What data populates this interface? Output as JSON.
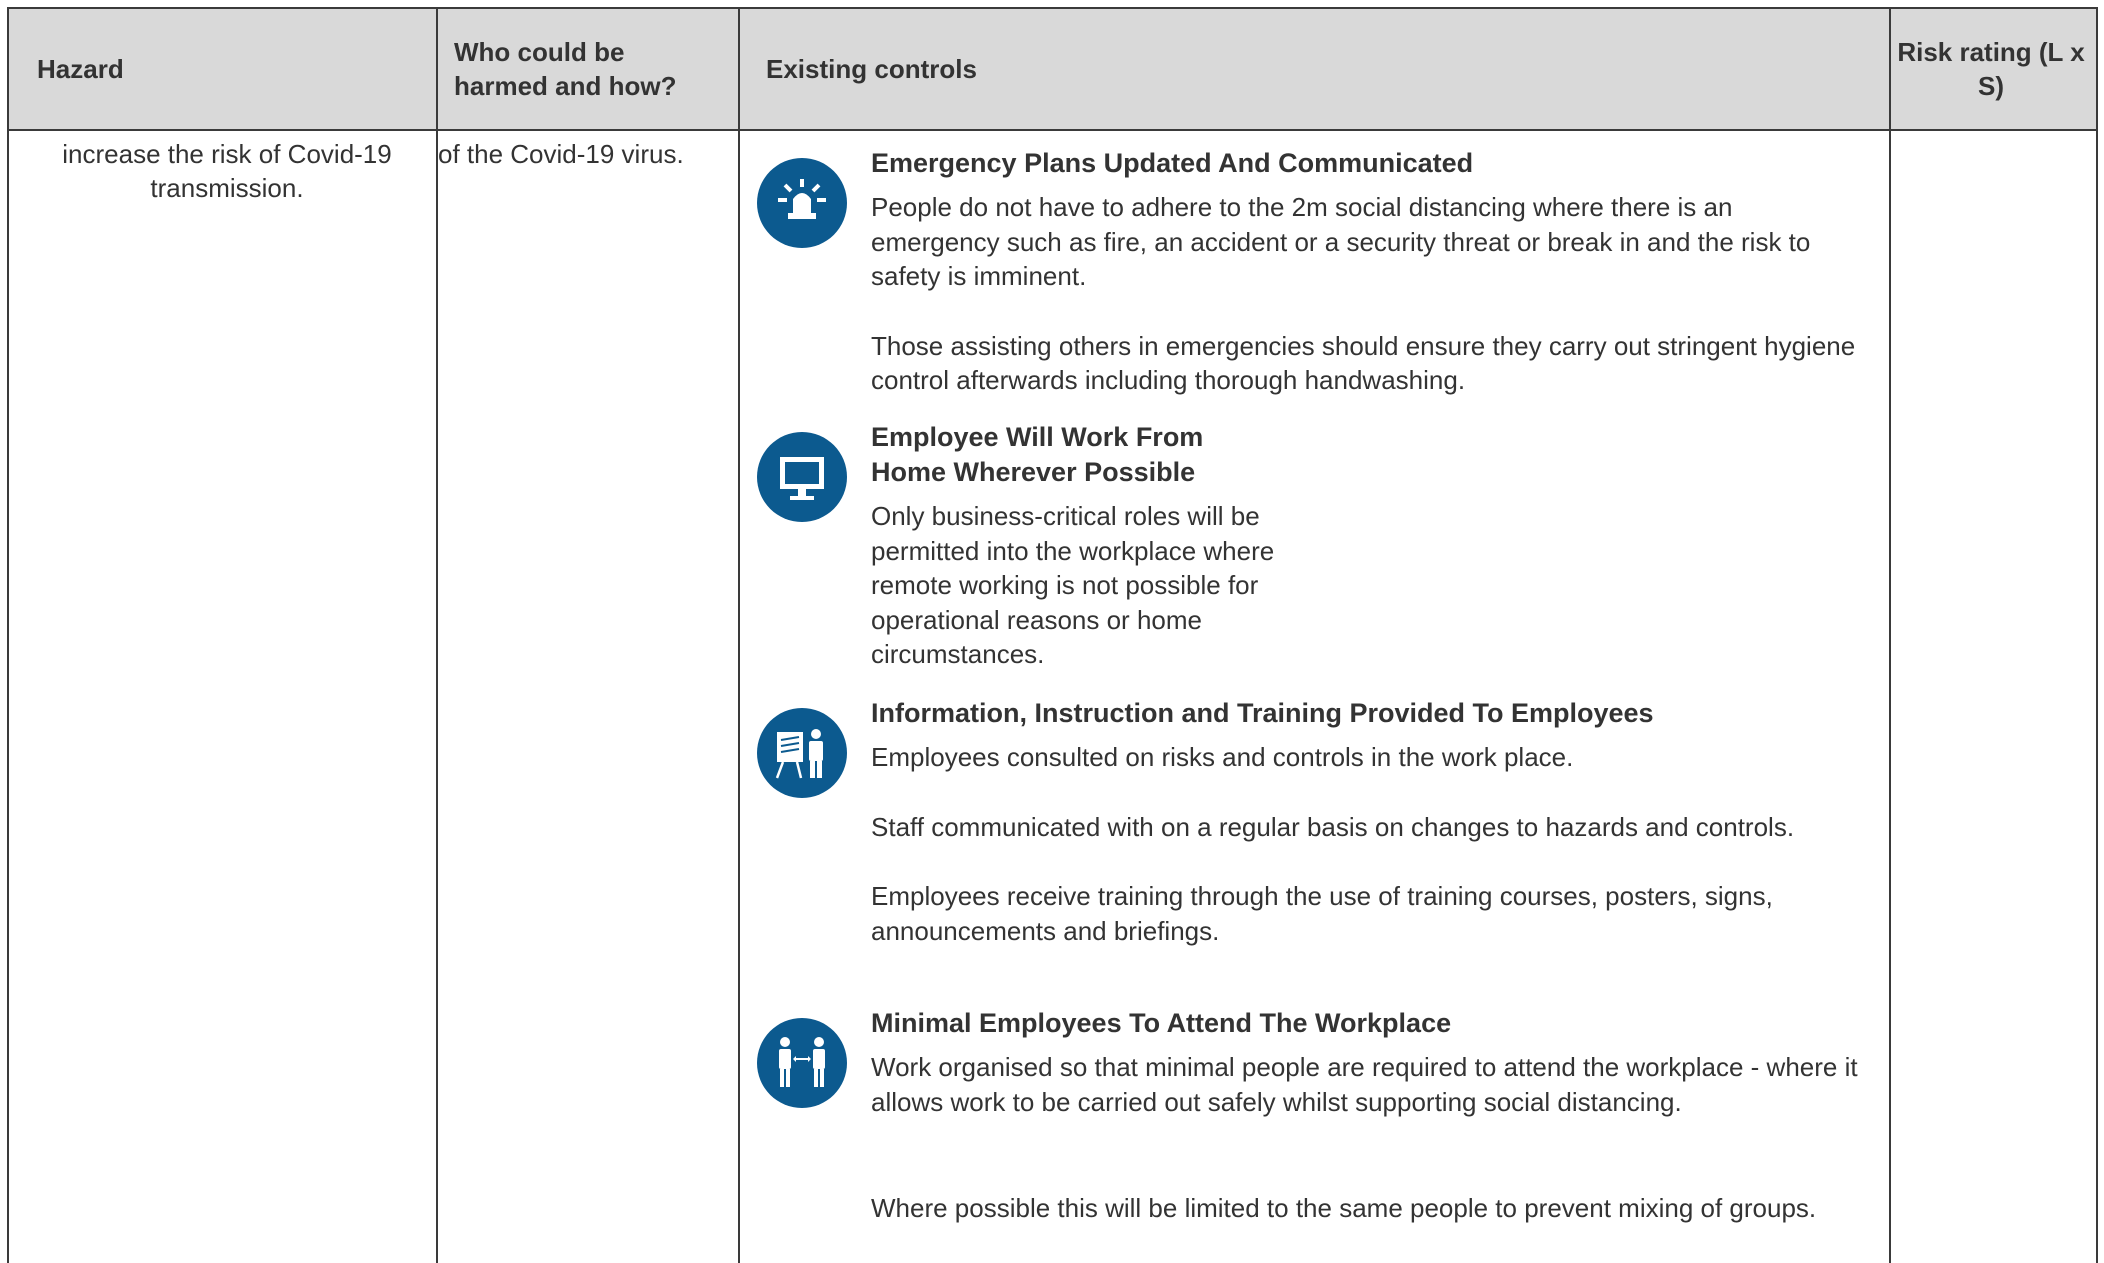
{
  "table": {
    "headers": {
      "hazard": "Hazard",
      "who": "Who could be harmed and how?",
      "controls": "Existing controls",
      "risk": "Risk rating (L x S)"
    },
    "hazard_text": "increase the risk of Covid-19 transmission.",
    "who_text": "of the Covid-19 virus.",
    "risk_text": "",
    "controls": [
      {
        "icon": "emergency-siren-icon",
        "title": "Emergency Plans Updated And Communicated",
        "paragraphs": [
          "People do not have to adhere to the 2m social distancing where there is an emergency such as fire, an accident or a security threat or break in and the risk to safety is imminent.",
          "Those assisting others in emergencies should ensure they carry out stringent hygiene control afterwards including thorough handwashing."
        ]
      },
      {
        "icon": "computer-monitor-icon",
        "title": "Employee Will Work From Home Wherever Possible",
        "paragraphs": [
          "Only business-critical roles will be permitted into the workplace where remote working is not possible for operational reasons or home circumstances."
        ]
      },
      {
        "icon": "training-presentation-icon",
        "title": "Information, Instruction and Training Provided To Employees",
        "paragraphs": [
          "Employees consulted on risks and controls in the work place.",
          "Staff communicated with on a regular basis on changes to hazards and controls.",
          "Employees receive training through the use of training courses, posters, signs, announcements and briefings."
        ]
      },
      {
        "icon": "social-distancing-icon",
        "title": "Minimal Employees To Attend The Workplace",
        "paragraphs": [
          "Work organised so that minimal people are required to attend the workplace - where it allows work to be carried out safely whilst supporting social distancing.",
          "Where possible this will be limited to the same people to prevent mixing of groups."
        ]
      }
    ],
    "colors": {
      "header_bg": "#d9d9d9",
      "icon_bg": "#0c5a8f",
      "border": "#3a3a3a",
      "text": "#333333"
    }
  }
}
